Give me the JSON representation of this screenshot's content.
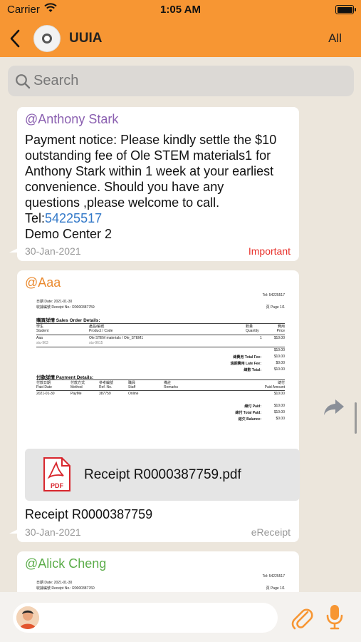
{
  "status_bar": {
    "carrier": "Carrier",
    "time": "1:05 AM"
  },
  "header": {
    "title": "UUIA",
    "filter_label": "All"
  },
  "search": {
    "placeholder": "Search"
  },
  "colors": {
    "accent": "#f79633",
    "important": "#e8312b",
    "link": "#3278c8"
  },
  "messages": [
    {
      "sender": "@Anthony Stark",
      "sender_color": "#8a5fb0",
      "text_lines": [
        "Payment notice: Please kindly settle the $10",
        "outstanding fee of Ole STEM materials1 for",
        "Anthony Stark within 1 week at your earliest",
        "convenience. Should you have any",
        "questions ,please welcome to call."
      ],
      "tel_label": "Tel:",
      "tel_number": "54225517",
      "center": "Demo Center 2",
      "date": "30-Jan-2021",
      "tag": "Important"
    },
    {
      "sender": "@Aaa",
      "sender_color": "#ea8a2f",
      "receipt": {
        "top_right": "Tel: 54225517",
        "date_line": "日期 Date: 2021-01-30",
        "receipt_no": "收據編號 Receipt No.: R0000387759",
        "page": "頁 Page 1/1",
        "sales_title": "購買詳情 Sales Order Details:",
        "sales_headers": [
          "學生",
          "產品/編號",
          "數量",
          "費用"
        ],
        "sales_headers_en": [
          "Student",
          "Product / Code",
          "Quantity",
          "Price"
        ],
        "sales_row": [
          "Aaa",
          "Ole STEM materials / Ole_STEM1",
          "1",
          "$10.00"
        ],
        "sales_row_sub": [
          "stu-963",
          "stu-9615"
        ],
        "sales_subtotal": "$10.00",
        "totals": [
          {
            "label": "總費用 Total Fee:",
            "value": "$10.00"
          },
          {
            "label": "過期費用 Late Fee:",
            "value": "$0.00"
          },
          {
            "label": "總數 Total:",
            "value": "$10.00"
          }
        ],
        "payment_title": "付款詳情 Payment Details:",
        "pay_headers": [
          "付款日期",
          "付款方式",
          "參考編號",
          "職員",
          "備註",
          "總付"
        ],
        "pay_headers_en": [
          "Paid Date",
          "Method",
          "Ref. No.",
          "Staff",
          "Remarks",
          "Paid Amount"
        ],
        "pay_row": [
          "2021-01-30",
          "PayMe",
          "387759",
          "Online",
          "",
          "$10.00"
        ],
        "pay_totals": [
          {
            "label": "總付 Paid:",
            "value": "$10.00"
          },
          {
            "label": "總付 Total Paid:",
            "value": "$10.00"
          },
          {
            "label": "結欠 Balance:",
            "value": "$0.00"
          }
        ]
      },
      "attachment": {
        "icon": "pdf-file-icon",
        "filename": "Receipt R0000387759.pdf",
        "icon_label": "PDF"
      },
      "text": "Receipt R0000387759",
      "date": "30-Jan-2021",
      "tag": "eReceipt"
    },
    {
      "sender": "@Alick Cheng",
      "sender_color": "#5cad4a",
      "receipt": {
        "top_right": "Tel: 54225517",
        "date_line": "日期 Date: 2021-01-30",
        "receipt_no": "收據編號 Receipt No.: R0000387760",
        "page": "頁 Page 1/1"
      }
    }
  ],
  "composer": {
    "icons": [
      "avatar",
      "paperclip-icon",
      "microphone-icon"
    ]
  }
}
